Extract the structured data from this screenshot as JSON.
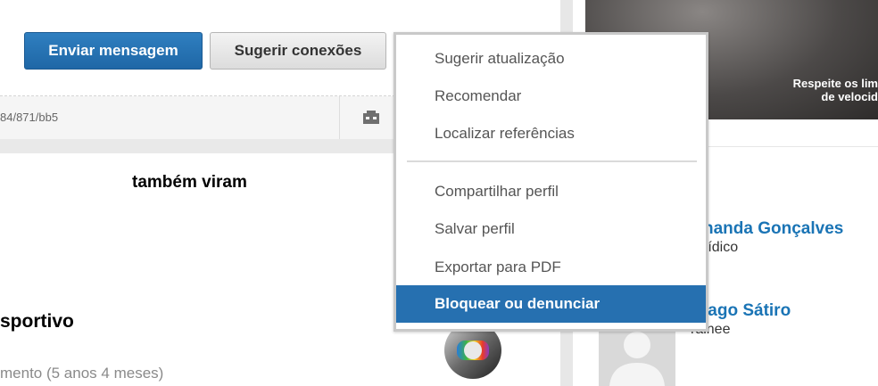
{
  "actions": {
    "send_message": "Enviar mensagem",
    "suggest_connections": "Sugerir conexões"
  },
  "url_fragment": "84/871/bb5",
  "experience": {
    "title": "sportivo",
    "duration": "mento (5 anos 4 meses)"
  },
  "ad": {
    "line1": "Respeite os lim",
    "line2": "de velocid"
  },
  "sidebar": {
    "heading": "também viram",
    "people": [
      {
        "name": "nanda Gonçalves",
        "role": "rídico"
      },
      {
        "name": "iago Sátiro",
        "role": "rainee"
      }
    ]
  },
  "menu": {
    "group1": [
      {
        "label": "Sugerir atualização"
      },
      {
        "label": "Recomendar"
      },
      {
        "label": "Localizar referências"
      }
    ],
    "group2": [
      {
        "label": "Compartilhar perfil"
      },
      {
        "label": "Salvar perfil"
      },
      {
        "label": "Exportar para PDF"
      },
      {
        "label": "Bloquear ou denunciar",
        "active": true
      }
    ]
  },
  "colors": {
    "primary_button": "#1f67a6",
    "menu_active": "#2670b0",
    "link": "#1a74b5"
  }
}
